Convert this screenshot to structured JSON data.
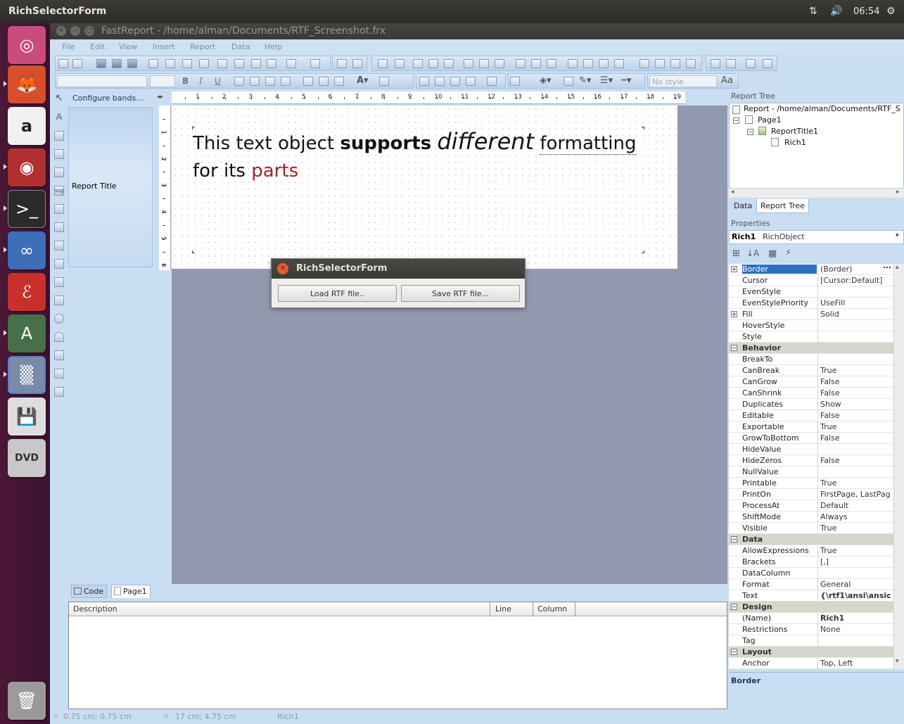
{
  "top_bar": {
    "app_title": "RichSelectorForm",
    "clock": "06:54"
  },
  "window": {
    "title": "FastReport - /home/alman/Documents/RTF_Screenshot.frx"
  },
  "menu": [
    "File",
    "Edit",
    "View",
    "Insert",
    "Report",
    "Data",
    "Help"
  ],
  "formatting": {
    "style_placeholder": "No style"
  },
  "bands": {
    "configure_label": "Configure bands...",
    "report_title_band": "Report Title"
  },
  "ruler_h": [
    "1",
    "2",
    "3",
    "4",
    "5",
    "6",
    "7",
    "8",
    "9",
    "10",
    "11",
    "12",
    "13",
    "14",
    "15",
    "16",
    "17",
    "18",
    "19"
  ],
  "ruler_v": [
    "1",
    "2",
    "3",
    "4",
    "5",
    "6"
  ],
  "rich_text": {
    "part1": "This text object ",
    "bold": "supports",
    "italic": "different",
    "underline": "formatting",
    "part2": "for its ",
    "colored": "parts",
    "colored_color": "#a1252a"
  },
  "dialog": {
    "title": "RichSelectorForm",
    "load_button": "Load RTF file..",
    "save_button": "Save RTF file..."
  },
  "bottom_tabs": {
    "code": "Code",
    "page1": "Page1"
  },
  "messages": {
    "col_description": "Description",
    "col_line": "Line",
    "col_column": "Column"
  },
  "status": {
    "position": "0.75 cm; 0.75 cm",
    "size": "17 cm; 4.75 cm",
    "object": "Rich1"
  },
  "report_tree": {
    "header": "Report Tree",
    "root": "Report - /home/alman/Documents/RTF_S",
    "page": "Page1",
    "band": "ReportTitle1",
    "object": "Rich1",
    "tab_data": "Data",
    "tab_tree": "Report Tree"
  },
  "properties": {
    "header": "Properties",
    "selected_name": "Rich1",
    "selected_type": "RichObject",
    "description_title": "Border",
    "rows": [
      {
        "name": "Border",
        "value": "(Border)",
        "expander": "+",
        "selected": true
      },
      {
        "name": "Cursor",
        "value": "[Cursor:Default]"
      },
      {
        "name": "EvenStyle",
        "value": ""
      },
      {
        "name": "EvenStylePriority",
        "value": "UseFill"
      },
      {
        "name": "Fill",
        "value": "Solid",
        "expander": "+"
      },
      {
        "name": "HoverStyle",
        "value": ""
      },
      {
        "name": "Style",
        "value": ""
      },
      {
        "name": "Behavior",
        "category": true
      },
      {
        "name": "BreakTo",
        "value": ""
      },
      {
        "name": "CanBreak",
        "value": "True"
      },
      {
        "name": "CanGrow",
        "value": "False"
      },
      {
        "name": "CanShrink",
        "value": "False"
      },
      {
        "name": "Duplicates",
        "value": "Show"
      },
      {
        "name": "Editable",
        "value": "False"
      },
      {
        "name": "Exportable",
        "value": "True"
      },
      {
        "name": "GrowToBottom",
        "value": "False"
      },
      {
        "name": "HideValue",
        "value": ""
      },
      {
        "name": "HideZeros",
        "value": "False"
      },
      {
        "name": "NullValue",
        "value": ""
      },
      {
        "name": "Printable",
        "value": "True"
      },
      {
        "name": "PrintOn",
        "value": "FirstPage, LastPag"
      },
      {
        "name": "ProcessAt",
        "value": "Default"
      },
      {
        "name": "ShiftMode",
        "value": "Always"
      },
      {
        "name": "Visible",
        "value": "True"
      },
      {
        "name": "Data",
        "category": true
      },
      {
        "name": "AllowExpressions",
        "value": "True"
      },
      {
        "name": "Brackets",
        "value": "[,]"
      },
      {
        "name": "DataColumn",
        "value": ""
      },
      {
        "name": "Format",
        "value": "General"
      },
      {
        "name": "Text",
        "value": "{\\rtf1\\ansi\\ansic",
        "bold": true
      },
      {
        "name": "Design",
        "category": true
      },
      {
        "name": "(Name)",
        "value": "Rich1",
        "bold": true
      },
      {
        "name": "Restrictions",
        "value": "None"
      },
      {
        "name": "Tag",
        "value": ""
      },
      {
        "name": "Layout",
        "category": true
      },
      {
        "name": "Anchor",
        "value": "Top, Left"
      }
    ]
  }
}
